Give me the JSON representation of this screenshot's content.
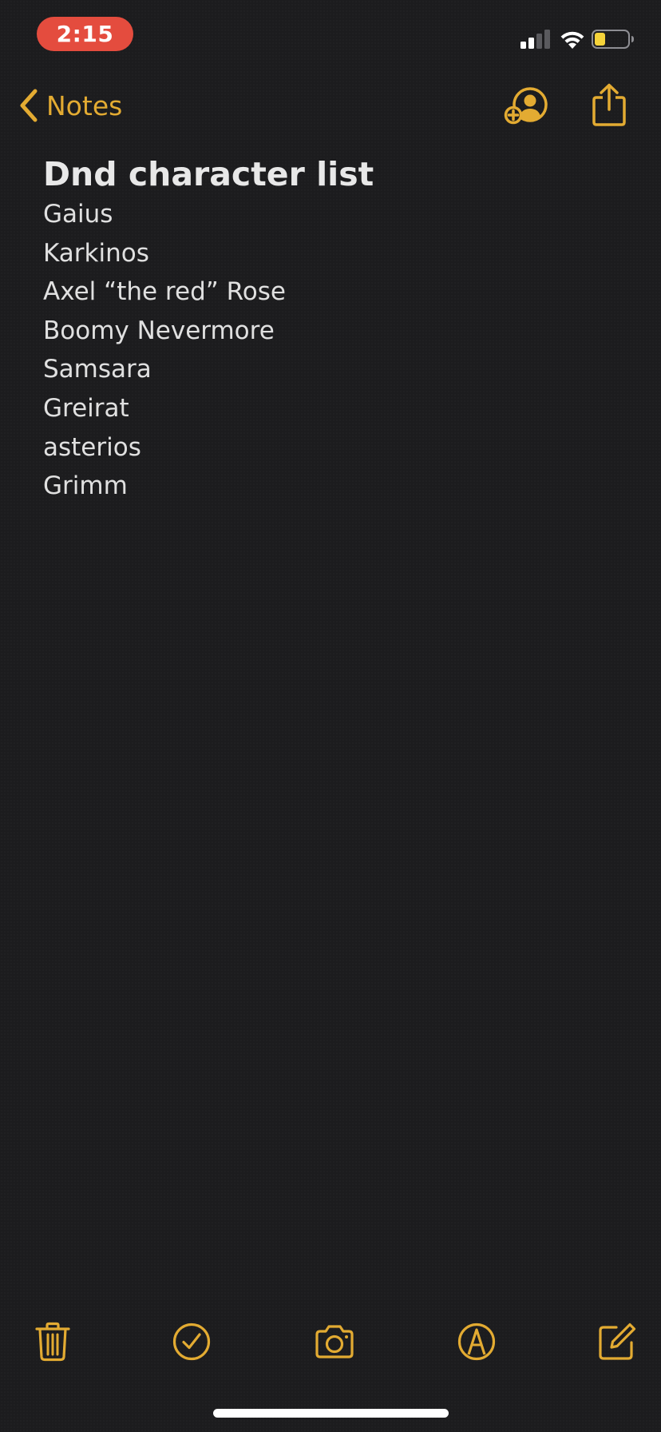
{
  "status_bar": {
    "time": "2:15",
    "time_pill_color": "#e44c3e",
    "signal_bars_active": 2,
    "signal_bars_total": 4,
    "battery_level": 0.25,
    "battery_color": "#f5d33a"
  },
  "nav": {
    "back_label": "Notes",
    "accent_color": "#e3ab32",
    "icons": [
      "chevron-left-icon",
      "add-person-icon",
      "share-icon"
    ]
  },
  "note": {
    "title": "Dnd character list",
    "lines": [
      "Gaius",
      "Karkinos",
      "Axel “the red” Rose",
      "Boomy Nevermore",
      "Samsara",
      "Greirat",
      "asterios",
      "Grimm"
    ]
  },
  "toolbar": {
    "icons": [
      "trash-icon",
      "checklist-icon",
      "camera-icon",
      "markup-pen-icon",
      "compose-icon"
    ]
  }
}
